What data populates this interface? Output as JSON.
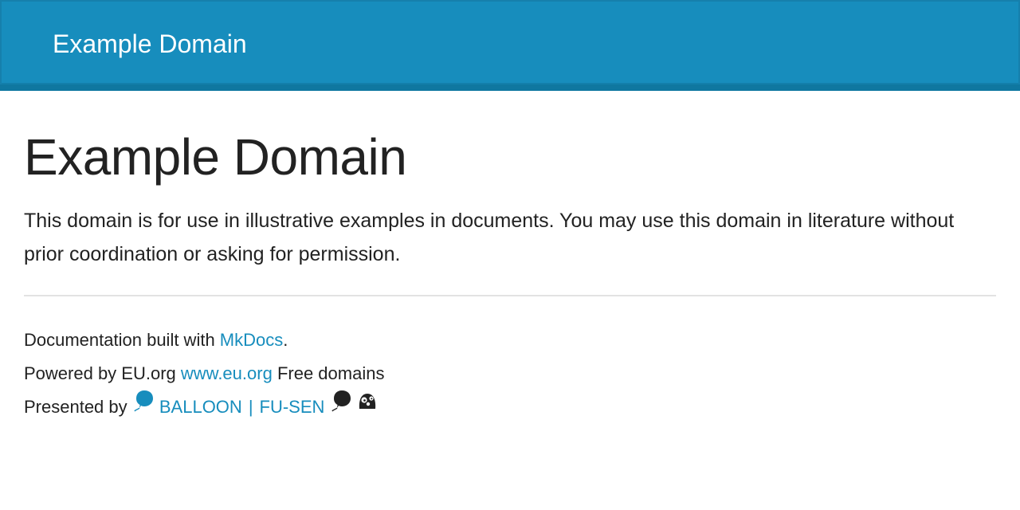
{
  "header": {
    "site_name": "Example Domain"
  },
  "main": {
    "title": "Example Domain",
    "intro": "This domain is for use in illustrative examples in documents. You may use this domain in literature without prior coordination or asking for permission."
  },
  "footer": {
    "built_prefix": "Documentation built with ",
    "built_link": "MkDocs",
    "built_suffix": ".",
    "powered_prefix": "Powered by EU.org ",
    "powered_link": "www.eu.org",
    "powered_suffix": " Free domains",
    "presented_prefix": "Presented by ",
    "balloon_link": "BALLOON",
    "separator": "|",
    "fusen_link": "FU-SEN",
    "icons": [
      "balloon-icon",
      "balloon-dark-icon",
      "mascot-icon"
    ]
  },
  "colors": {
    "brand": "#178dbd",
    "navbar_border": "#0f77a0",
    "text": "#222222",
    "divider": "#e2e2e2"
  }
}
